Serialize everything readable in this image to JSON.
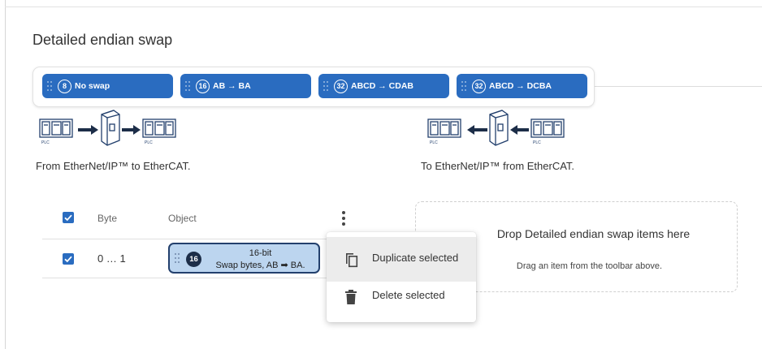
{
  "title": "Detailed endian swap",
  "toolbar": {
    "items": [
      {
        "badge": "8",
        "label": "No swap"
      },
      {
        "badge": "16",
        "label": "AB → BA"
      },
      {
        "badge": "32",
        "label": "ABCD → CDAB"
      },
      {
        "badge": "32",
        "label": "ABCD → DCBA"
      }
    ]
  },
  "diagrams": {
    "left_label": "From EtherNet/IP™ to EtherCAT.",
    "right_label": "To EtherNet/IP™ from EtherCAT.",
    "plc_text": "PLC"
  },
  "table": {
    "headers": {
      "byte": "Byte",
      "object": "Object"
    },
    "rows": [
      {
        "byte": "0 … 1",
        "badge": "16",
        "title": "16-bit",
        "desc": "Swap bytes, AB ➡ BA."
      }
    ]
  },
  "dropzone": {
    "title": "Drop Detailed endian swap items here",
    "subtitle": "Drag an item from the toolbar above."
  },
  "menu": {
    "items": [
      {
        "label": "Duplicate selected",
        "icon": "copy-icon"
      },
      {
        "label": "Delete selected",
        "icon": "trash-icon"
      }
    ]
  },
  "colors": {
    "accent": "#2a6cc0",
    "chip_bg": "#bcd5ef",
    "chip_border": "#23406d"
  }
}
